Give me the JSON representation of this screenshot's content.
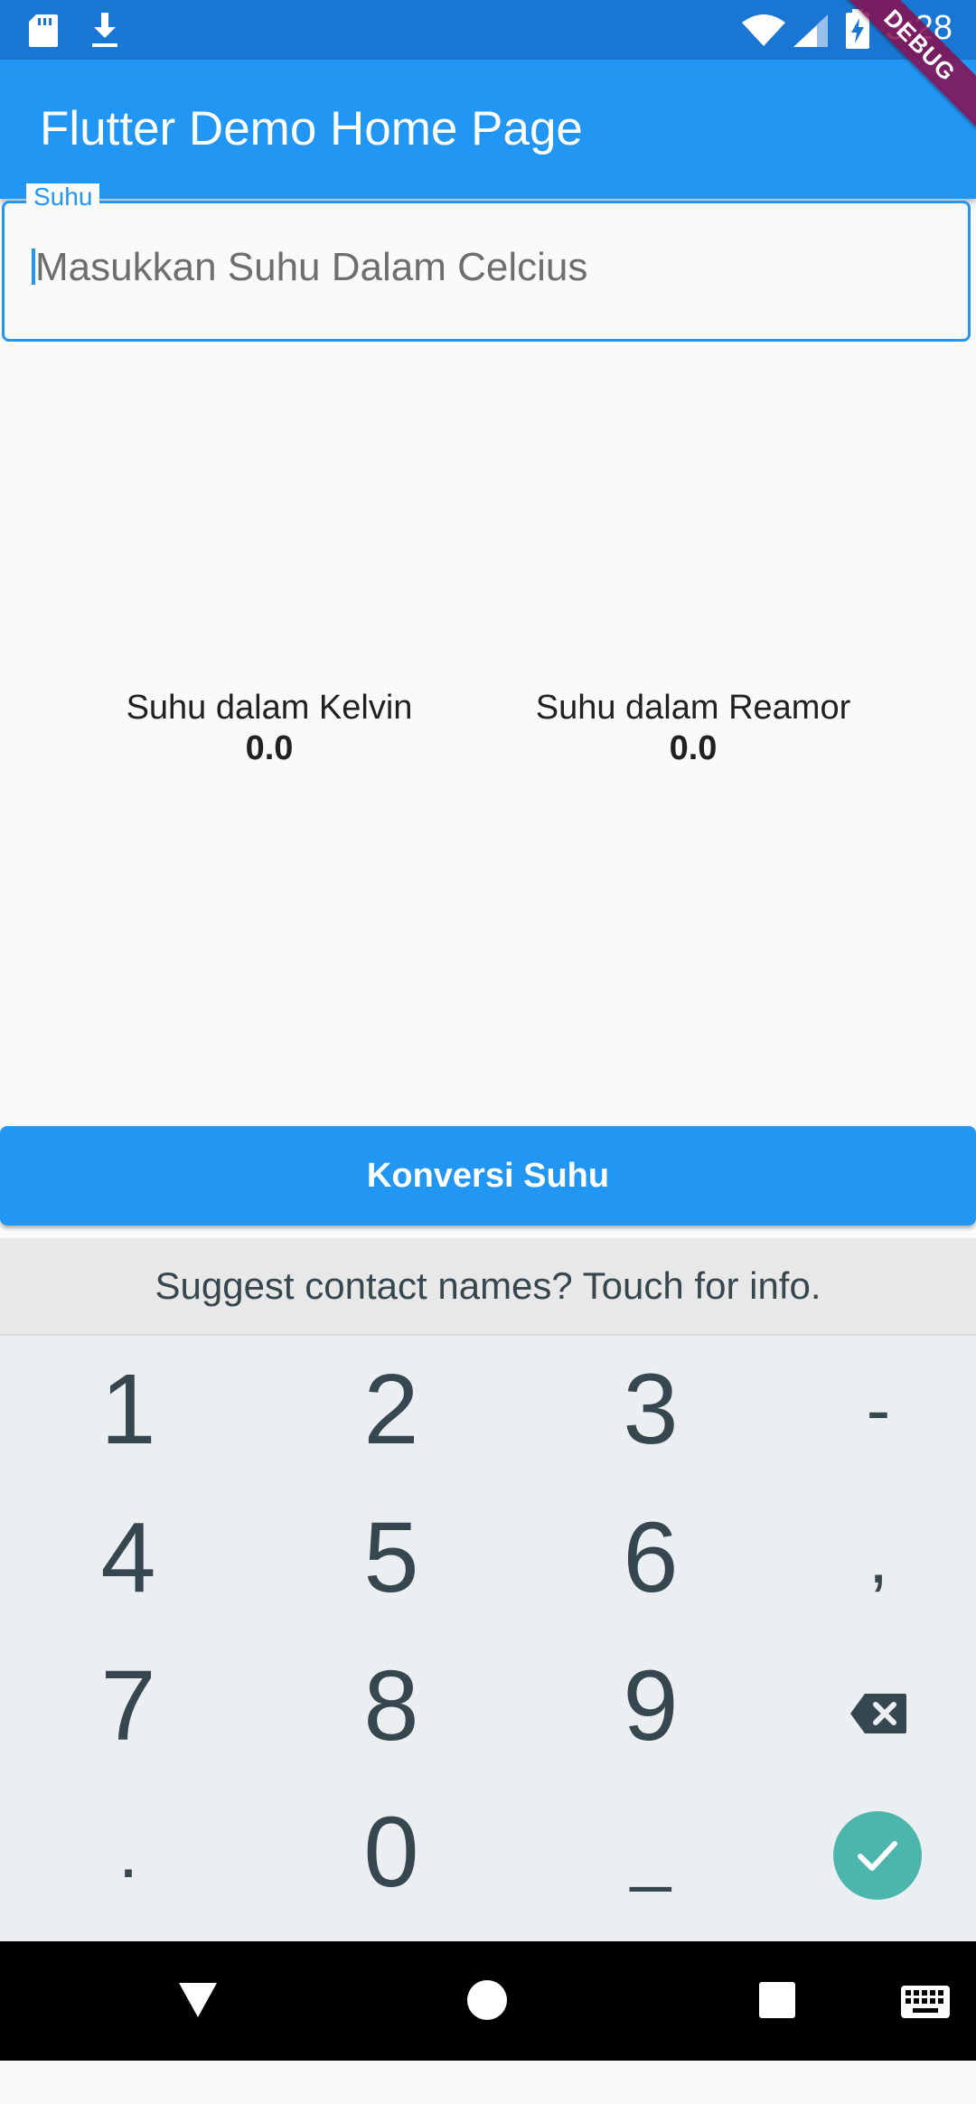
{
  "status_bar": {
    "time": "3:28",
    "icons": [
      "sd-card-icon",
      "download-icon",
      "wifi-icon",
      "cell-signal-icon",
      "battery-charging-icon"
    ]
  },
  "debug_banner": "DEBUG",
  "app_bar": {
    "title": "Flutter Demo Home Page"
  },
  "input": {
    "label": "Suhu",
    "placeholder": "Masukkan Suhu Dalam Celcius",
    "value": ""
  },
  "results": {
    "kelvin": {
      "label": "Suhu dalam Kelvin",
      "value": "0.0"
    },
    "reamur": {
      "label": "Suhu dalam Reamor",
      "value": "0.0"
    }
  },
  "button": {
    "label": "Konversi Suhu"
  },
  "keyboard": {
    "suggestion": "Suggest contact names? Touch for info.",
    "rows": [
      [
        "1",
        "2",
        "3",
        "-"
      ],
      [
        "4",
        "5",
        "6",
        ","
      ],
      [
        "7",
        "8",
        "9",
        "backspace-icon"
      ],
      [
        ".",
        "0",
        "_",
        "enter-check-icon"
      ]
    ]
  },
  "nav_bar": {
    "icons": [
      "back-icon",
      "home-icon",
      "recents-icon",
      "keyboard-switch-icon"
    ]
  },
  "colors": {
    "status_bar": "#1976d2",
    "primary": "#2196f3",
    "background": "#fafafa",
    "keyboard_bg": "#eceff1",
    "enter_key": "#4db6ac"
  }
}
